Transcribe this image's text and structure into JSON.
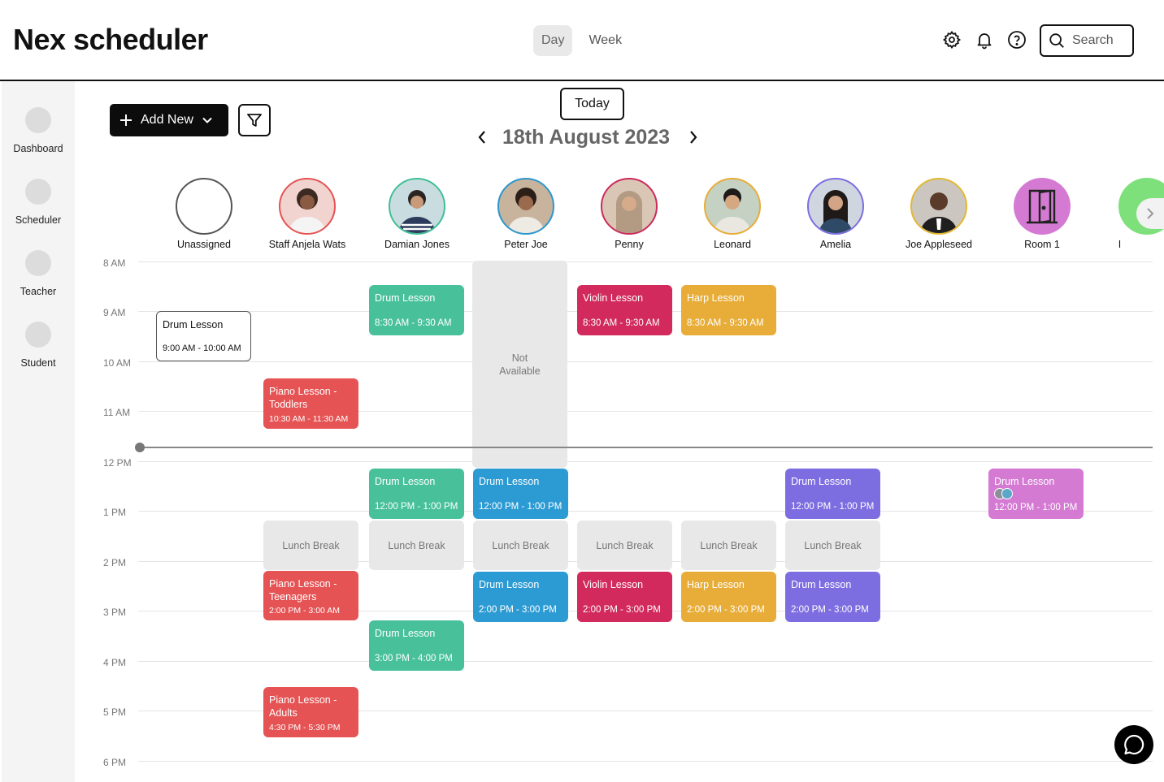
{
  "app": {
    "title": "Nex scheduler"
  },
  "view_toggle": {
    "day": "Day",
    "week": "Week",
    "selected": "Day"
  },
  "header_icons": [
    "gear-icon",
    "bell-icon",
    "help-icon"
  ],
  "search": {
    "placeholder": "Search"
  },
  "sidebar": {
    "items": [
      {
        "label": "Dashboard"
      },
      {
        "label": "Scheduler"
      },
      {
        "label": "Teacher"
      },
      {
        "label": "Student"
      }
    ]
  },
  "toolbar": {
    "add_new_label": "Add New",
    "today_label": "Today",
    "date": "18th August 2023"
  },
  "resources": [
    {
      "name": "Unassigned",
      "ring": "#555555",
      "fill": "#ffffff"
    },
    {
      "name": "Staff Anjela Wats",
      "ring": "#e55354",
      "fill": "#f1d3d0"
    },
    {
      "name": "Damian Jones",
      "ring": "#3fbf97",
      "fill": "#c9dde0"
    },
    {
      "name": "Peter Joe",
      "ring": "#2b97cf",
      "fill": "#c8b39c"
    },
    {
      "name": "Penny",
      "ring": "#cc2a5a",
      "fill": "#d9c6b5"
    },
    {
      "name": "Leonard",
      "ring": "#e8ad38",
      "fill": "#c5d1c2"
    },
    {
      "name": "Amelia",
      "ring": "#7c6ee0",
      "fill": "#cfd6df"
    },
    {
      "name": "Joe Appleseed",
      "ring": "#e2b832",
      "fill": "#cbc7c0"
    },
    {
      "name": "Room 1",
      "ring": "#d47ad3",
      "fill": "#d47ad3"
    },
    {
      "name": "I",
      "ring": "#7ee07a",
      "fill": "#7ee07a"
    }
  ],
  "time_labels": [
    "8 AM",
    "9 AM",
    "10 AM",
    "11 AM",
    "12 PM",
    "1 PM",
    "2 PM",
    "3 PM",
    "4 PM",
    "5 PM",
    "6 PM"
  ],
  "events": [
    {
      "title": "Drum Lesson",
      "time": "9:00 AM - 10:00 AM",
      "color": "#ffffff"
    },
    {
      "title": "Piano Lesson - Toddlers",
      "time": "10:30 AM - 11:30 AM",
      "color": "#e55354"
    },
    {
      "title": "Piano Lesson - Teenagers",
      "time": "2:00 PM - 3:00 AM",
      "color": "#e55354"
    },
    {
      "title": "Piano Lesson - Adults",
      "time": "4:30 PM - 5:30 PM",
      "color": "#e55354"
    },
    {
      "title": "Drum Lesson",
      "time": "8:30 AM - 9:30 AM",
      "color": "#48c19b"
    },
    {
      "title": "Drum Lesson",
      "time": "12:00 PM - 1:00 PM",
      "color": "#48c19b"
    },
    {
      "title": "Drum Lesson",
      "time": "3:00 PM - 4:00 PM",
      "color": "#48c19b"
    },
    {
      "title": "Drum Lesson",
      "time": "12:00 PM - 1:00 PM",
      "color": "#2d9bd3"
    },
    {
      "title": "Drum Lesson",
      "time": "2:00 PM - 3:00 PM",
      "color": "#2d9bd3"
    },
    {
      "title": "Violin Lesson",
      "time": "8:30 AM - 9:30 AM",
      "color": "#d22a5d"
    },
    {
      "title": "Violin Lesson",
      "time": "2:00 PM - 3:00 PM",
      "color": "#d22a5d"
    },
    {
      "title": "Harp Lesson",
      "time": "8:30 AM - 9:30 AM",
      "color": "#e8ad38"
    },
    {
      "title": "Harp Lesson",
      "time": "2:00 PM - 3:00 PM",
      "color": "#e8ad38"
    },
    {
      "title": "Drum Lesson",
      "time": "12:00 PM - 1:00 PM",
      "color": "#7c6ee0"
    },
    {
      "title": "Drum Lesson",
      "time": "2:00 PM - 3:00 PM",
      "color": "#7c6ee0"
    },
    {
      "title": "Drum Lesson",
      "time": "12:00 PM - 1:00 PM",
      "color": "#d47ad3"
    }
  ],
  "blocks": {
    "not_available": "Not Available",
    "lunch_break": "Lunch Break"
  }
}
